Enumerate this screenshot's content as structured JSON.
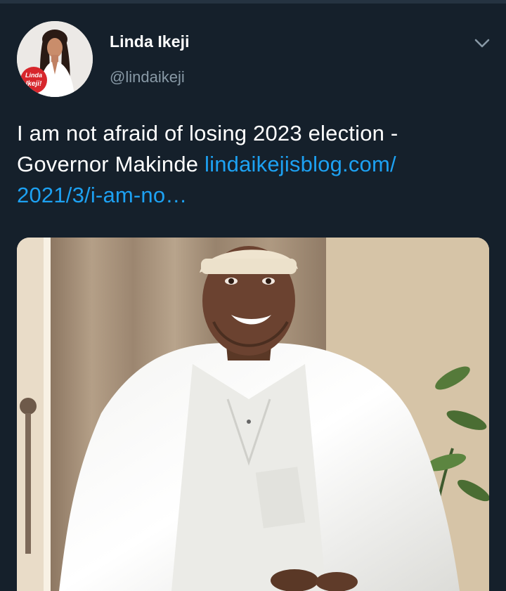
{
  "author": {
    "name": "Linda Ikeji",
    "handle": "@lindaikeji",
    "avatar_badge": "Linda Ikeji!"
  },
  "tweet": {
    "text": "I am not afraid of losing 2023 election - Governor Makinde ",
    "link_line1": "lindaikejisblog.com/",
    "link_line2": "2021/3/i-am-no…"
  },
  "icons": {
    "menu": "chevron-down-icon"
  },
  "colors": {
    "background": "#15202b",
    "link": "#1da1f2",
    "secondary_text": "#8899a6"
  }
}
